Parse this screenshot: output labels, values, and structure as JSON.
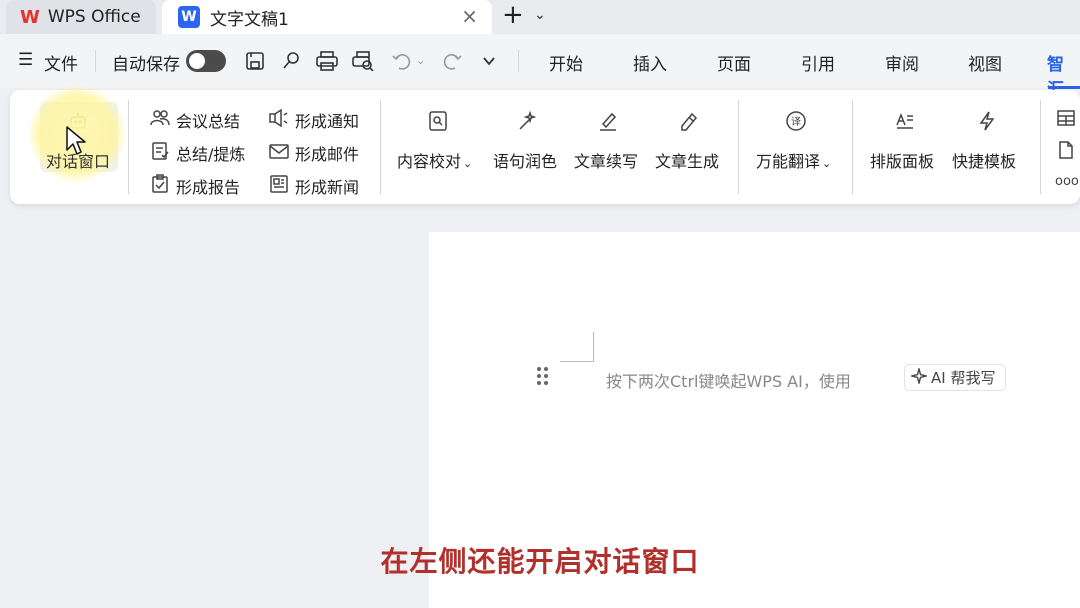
{
  "tabs": {
    "home_label": "WPS Office",
    "doc_label": "文字文稿1",
    "doc_icon_letter": "W",
    "close_glyph": "×",
    "add_glyph": "+",
    "more_glyph": "⌄"
  },
  "menubar": {
    "file_label": "文件",
    "autosave_label": "自动保存",
    "autosave_on": false,
    "tabs": [
      "开始",
      "插入",
      "页面",
      "引用",
      "审阅",
      "视图",
      "智汇"
    ],
    "active_tab": "智汇"
  },
  "ribbon": {
    "dialog_window": "对话窗口",
    "meeting_summary": "会议总结",
    "summary_refine": "总结/提炼",
    "form_report": "形成报告",
    "form_notice": "形成通知",
    "form_email": "形成邮件",
    "form_news": "形成新闻",
    "content_proof": "内容校对",
    "sentence_polish": "语句润色",
    "article_continue": "文章续写",
    "article_generate": "文章生成",
    "universal_translate": "万能翻译",
    "layout_panel": "排版面板",
    "quick_template": "快捷模板",
    "more_glyph": "ooo",
    "caret": "⌄"
  },
  "document": {
    "hint_text": "按下两次Ctrl键唤起WPS AI，使用",
    "ai_button_label": "AI 帮我写"
  },
  "subtitle": "在左侧还能开启对话窗口",
  "colors": {
    "accent": "#2a62e9",
    "wps_red": "#e6322b",
    "subtitle": "#b2302b",
    "highlight": "#fff59a"
  }
}
